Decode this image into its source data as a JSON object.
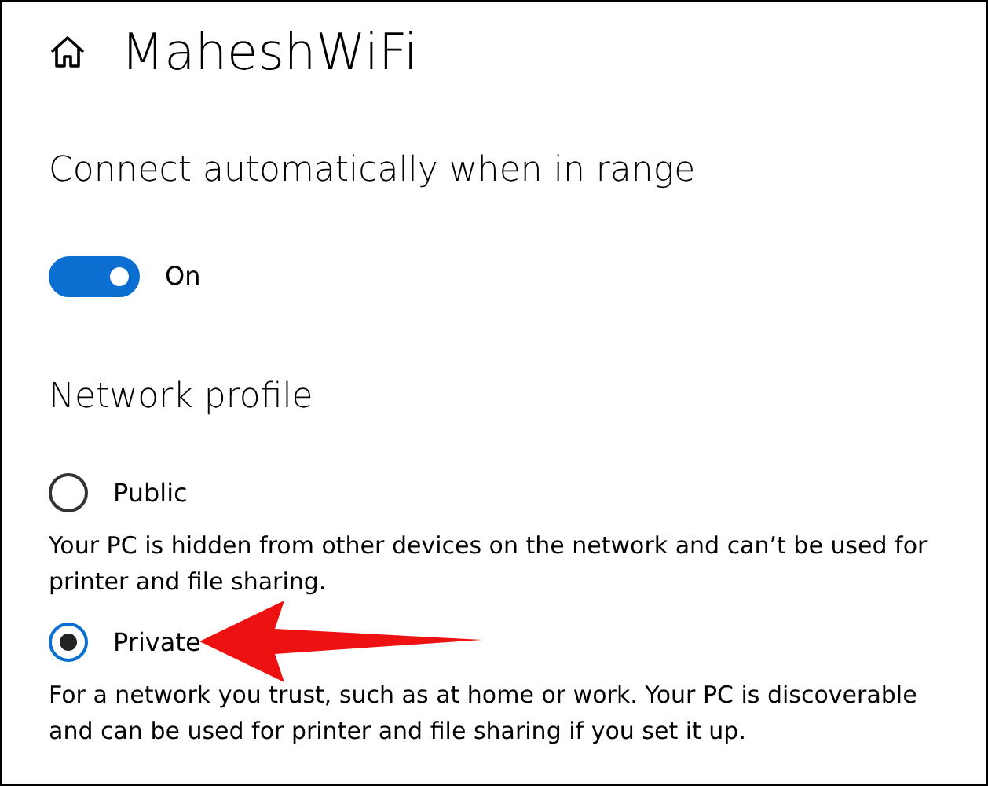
{
  "header": {
    "title": "MaheshWiFi"
  },
  "auto_connect": {
    "heading": "Connect automatically when in range",
    "on": true,
    "state_label": "On"
  },
  "network_profile": {
    "heading": "Network profile",
    "options": [
      {
        "label": "Public",
        "selected": false,
        "description": "Your PC is hidden from other devices on the network and can’t be used for printer and file sharing."
      },
      {
        "label": "Private",
        "selected": true,
        "description": "For a network you trust, such as at home or work. Your PC is discoverable and can be used for printer and file sharing if you set it up."
      }
    ]
  }
}
